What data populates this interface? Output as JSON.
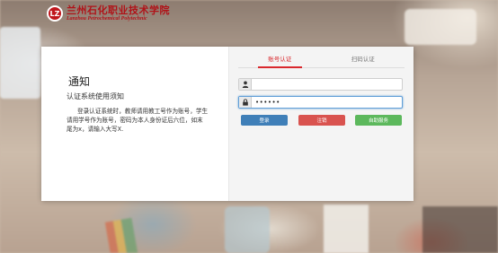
{
  "brand": {
    "name_cn": "兰州石化职业技术学院",
    "name_en": "Lanzhou Petrochemical Polytechnic",
    "logo_glyph": "LZ"
  },
  "notice": {
    "title": "通知",
    "subtitle": "认证系统使用须知",
    "body": "登录认证系统时，教师请用教工号作为账号，学生请用学号作为账号，密码为本人身份证后六位，如末尾为x，请输入大写X."
  },
  "login": {
    "tabs": [
      {
        "label": "账号认证",
        "active": true
      },
      {
        "label": "扫码认证",
        "active": false
      }
    ],
    "username_value": "",
    "password_value": "••••••",
    "buttons": {
      "login": "登录",
      "logout": "注销",
      "self_service": "自助服务"
    }
  },
  "colors": {
    "accent_red": "#d9282d",
    "login_blue": "#3f7fb8",
    "logout_red": "#d9534f",
    "self_green": "#5cb85c"
  },
  "icons": {
    "user": "user-icon",
    "lock": "lock-icon"
  }
}
